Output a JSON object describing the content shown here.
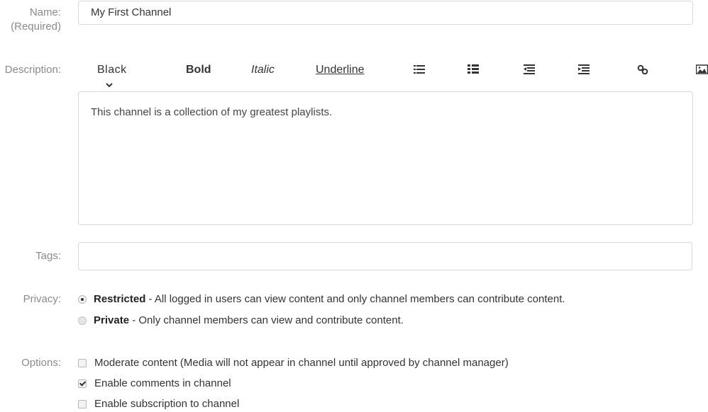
{
  "fields": {
    "name": {
      "label_line1": "Name:",
      "label_line2": "(Required)",
      "value": "My First Channel"
    },
    "description": {
      "label": "Description:",
      "value": "This channel is a collection of my greatest playlists.",
      "toolbar": {
        "color_label": "Black",
        "color_chevron": "❯",
        "bold_label": "Bold",
        "italic_label": "Italic",
        "underline_label": "Underline",
        "icons": [
          "unordered-list-icon",
          "ordered-list-icon",
          "outdent-icon",
          "indent-icon",
          "link-icon",
          "image-icon"
        ]
      }
    },
    "tags": {
      "label": "Tags:",
      "value": ""
    },
    "privacy": {
      "label": "Privacy:",
      "options": [
        {
          "title": "Restricted",
          "desc": " - All logged in users can view content and only channel members can contribute content.",
          "selected": true
        },
        {
          "title": "Private",
          "desc": " - Only channel members can view and contribute content.",
          "selected": false
        }
      ]
    },
    "options": {
      "label": "Options:",
      "items": [
        {
          "label": "Moderate content (Media will not appear in channel until approved by channel manager)",
          "checked": false
        },
        {
          "label": "Enable comments in channel",
          "checked": true
        },
        {
          "label": "Enable subscription to channel",
          "checked": false
        }
      ]
    }
  }
}
